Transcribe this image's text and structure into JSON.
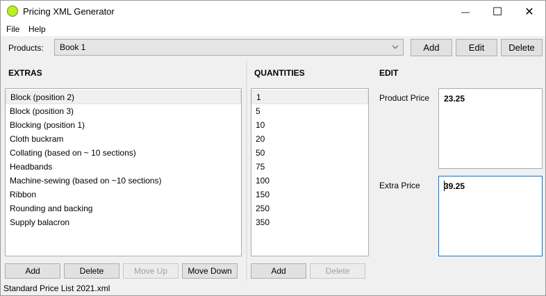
{
  "window": {
    "title": "Pricing XML Generator",
    "minimize_glyph": "—",
    "maximize_glyph": "☐",
    "close_glyph": "✕"
  },
  "menu": {
    "file": "File",
    "help": "Help"
  },
  "products": {
    "label": "Products:",
    "selected": "Book 1",
    "add_label": "Add",
    "edit_label": "Edit",
    "delete_label": "Delete"
  },
  "extras": {
    "header": "EXTRAS",
    "items": [
      "Block (position 2)",
      "Block (position 3)",
      "Blocking (position 1)",
      "Cloth buckram",
      "Collating (based on ~ 10 sections)",
      "Headbands",
      "Machine-sewing (based on ~10 sections)",
      "Ribbon",
      "Rounding and backing",
      "Supply balacron"
    ],
    "add_label": "Add",
    "delete_label": "Delete",
    "move_up_label": "Move Up",
    "move_down_label": "Move Down"
  },
  "quantities": {
    "header": "QUANTITIES",
    "items": [
      "1",
      "5",
      "10",
      "20",
      "50",
      "75",
      "100",
      "150",
      "250",
      "350"
    ],
    "add_label": "Add",
    "delete_label": "Delete"
  },
  "edit": {
    "header": "EDIT",
    "product_price_label": "Product Price",
    "product_price_value": "23.25",
    "extra_price_label": "Extra Price",
    "extra_price_value": "39.25"
  },
  "status": {
    "text": "Standard Price List 2021.xml"
  }
}
